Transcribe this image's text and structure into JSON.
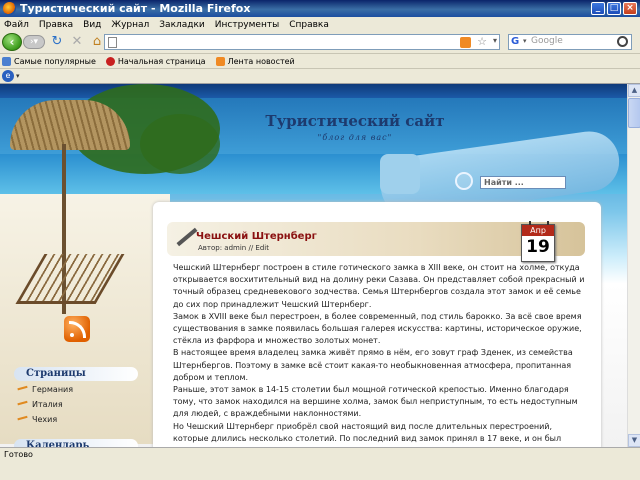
{
  "window": {
    "title": "Туристический сайт - Mozilla Firefox"
  },
  "menu": [
    "Файл",
    "Правка",
    "Вид",
    "Журнал",
    "Закладки",
    "Инструменты",
    "Справка"
  ],
  "search_engine": {
    "placeholder": "Google"
  },
  "bookmarks": [
    "Самые популярные",
    "Начальная страница",
    "Лента новостей"
  ],
  "site": {
    "title": "Туристический сайт",
    "subtitle": "\"блог для вас\"",
    "search_placeholder": "Найти ..."
  },
  "sidebar": {
    "pages_title": "Страницы",
    "pages": [
      "Германия",
      "Италия",
      "Чехия"
    ],
    "calendar_title": "Календарь"
  },
  "post": {
    "title": "Чешский Штернберг",
    "meta": "Автор: admin // Edit",
    "date_month": "Апр",
    "date_day": "19",
    "paragraphs": [
      "Чешский Штернберг построен в стиле готического замка в  XIII веке, он стоит на холме, откуда открывается восхитительный вид  на долину реки Сазава. Он представляет собой прекрасный и точный образец средневекового зодчества. Семья Штернбергов  создала этот замок и её семье до сих пор принадлежит Чешский Штернберг.",
      "Замок в  XVIII веке был перестроен, в более современный, под стиль барокко. За всё свое время существования в замке появилась большая галерея искусства: картины, историческое оружие, стёкла из фарфора и множество золотых монет.",
      "В настоящее время владелец замка живёт прямо в нём, его зовут граф Зденек, из семейства Штернбергов. Поэтому в замке всё стоит какая-то необыкновенная атмосфера, пропитанная добром и теплом.",
      "Раньше, этот замок в 14-15 столетии был мощной готической крепостью. Именно благодаря тому, что замок находился на вершине холма, замок был неприступным, то есть недоступным для людей, с враждебными наклонностями.",
      "Но Чешский Штернберг приобрёл свой настоящий вид после длительных перестроений, которые длились несколько столетий.  По последний вид замок принял в 17 веке, и он был выполнен в"
    ]
  },
  "status": "Готово"
}
